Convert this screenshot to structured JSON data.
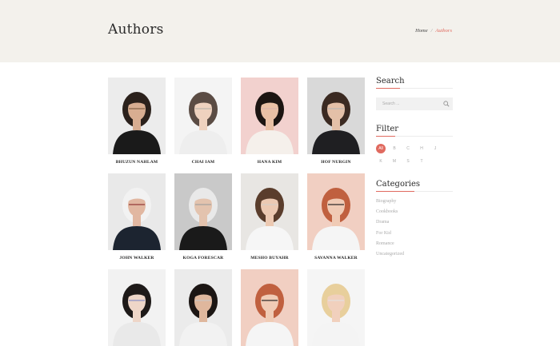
{
  "header": {
    "title": "Authors",
    "breadcrumb": {
      "home": "Home",
      "separator": "/",
      "current": "Authors"
    }
  },
  "authors": [
    {
      "name": "BHUZUN NAHLAM",
      "bg": "#ececec",
      "skin": "#d8ad91",
      "hair": "#2b211c",
      "shirt": "#1a1a1a",
      "accent": "#7a5a3e"
    },
    {
      "name": "CHAI IAM",
      "bg": "#f4f4f4",
      "skin": "#efd2bf",
      "hair": "#5b4c44",
      "shirt": "#eeeeee",
      "accent": "#b7b0aa"
    },
    {
      "name": "HANA KIM",
      "bg": "#f2d1ce",
      "skin": "#e9c0a5",
      "hair": "#1c1512",
      "shirt": "#f5f0eb",
      "accent": "#d9b3ae"
    },
    {
      "name": "HOF NURGIN",
      "bg": "#d9d9d9",
      "skin": "#e4c0a8",
      "hair": "#3b2a22",
      "shirt": "#1f1f22",
      "accent": "#b5b5b5"
    },
    {
      "name": "JOHN WALKER",
      "bg": "#e9e9e9",
      "skin": "#e1b7a1",
      "hair": "#f2f2f2",
      "shirt": "#1c2430",
      "accent": "#8b2a2a"
    },
    {
      "name": "KOGA FORESCAR",
      "bg": "#c9c9c9",
      "skin": "#e3c3ae",
      "hair": "#e9e9e9",
      "shirt": "#1a1a1a",
      "accent": "#9c9c9c"
    },
    {
      "name": "MESHO BUYAHR",
      "bg": "#e8e6e3",
      "skin": "#ecc9b2",
      "hair": "#5a3d2c",
      "shirt": "#f6f6f6",
      "accent": "#d5d0cb"
    },
    {
      "name": "SAVANNA WALKER",
      "bg": "#f1cfc2",
      "skin": "#f0cbb5",
      "hair": "#c0603f",
      "shirt": "#f5f5f5",
      "accent": "#151515"
    },
    {
      "name": "",
      "bg": "#f2f2f2",
      "skin": "#eed6c8",
      "hair": "#1e1a19",
      "shirt": "#e9e9e9",
      "accent": "#7c86c8"
    },
    {
      "name": "",
      "bg": "#ebebeb",
      "skin": "#dfb79d",
      "hair": "#1c1614",
      "shirt": "#f2f2f2",
      "accent": "#c9c9c9"
    },
    {
      "name": "",
      "bg": "#f1cfc2",
      "skin": "#f0cbb5",
      "hair": "#c0603f",
      "shirt": "#f5f5f5",
      "accent": "#151515"
    },
    {
      "name": "",
      "bg": "#f5f5f5",
      "skin": "#f1d0bd",
      "hair": "#e8cf9c",
      "shirt": "#f4f4f4",
      "accent": "#e2e2e2"
    }
  ],
  "sidebar": {
    "search": {
      "title": "Search",
      "placeholder": "Search ...",
      "icon": "search-icon"
    },
    "filter": {
      "title": "Filter",
      "letters": [
        "All",
        "B",
        "C",
        "H",
        "J",
        "K",
        "M",
        "S",
        "T"
      ],
      "active": "All"
    },
    "categories": {
      "title": "Categories",
      "items": [
        "Biography",
        "Cookbooks",
        "Drama",
        "For Kid",
        "Romance",
        "Uncategorized"
      ]
    }
  },
  "colors": {
    "accent": "#e06a5f",
    "hero_bg": "#f3f1ec"
  }
}
